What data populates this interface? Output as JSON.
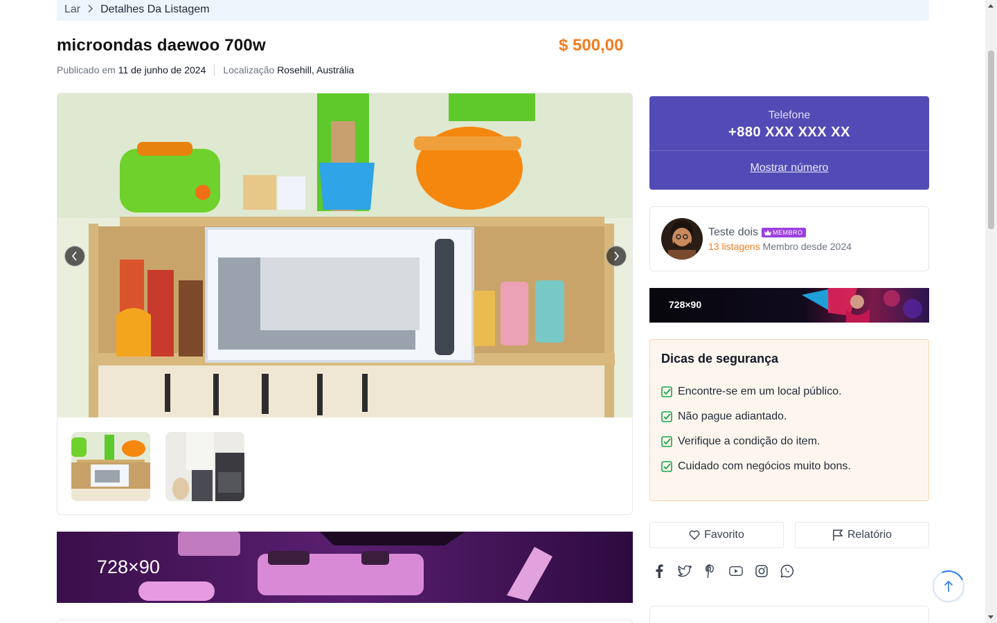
{
  "breadcrumb": {
    "home": "Lar",
    "current": "Detalhes Da Listagem"
  },
  "listing": {
    "title": "microondas daewoo 700w",
    "price": "$ 500,00",
    "published_label": "Publicado em",
    "published_date": "11 de junho de 2024",
    "location_label": "Localização",
    "location": "Rosehill, Austrália"
  },
  "gallery": {
    "thumb_count": 2
  },
  "banners": {
    "side_label": "728×90",
    "bottom_label": "728×90"
  },
  "contact": {
    "phone_label": "Telefone",
    "phone_number": "+880 XXX XXX XX",
    "show_number": "Mostrar número"
  },
  "seller": {
    "name": "Teste dois",
    "badge": "MEMBRO",
    "listings": "13 listagens",
    "member_since": "Membro desde 2024"
  },
  "safety": {
    "title": "Dicas de segurança",
    "tips": [
      "Encontre-se em um local público.",
      "Não pague adiantado.",
      "Verifique a condição do item.",
      "Cuidado com negócios muito bons."
    ]
  },
  "actions": {
    "favorite": "Favorito",
    "report": "Relatório"
  },
  "social": [
    "facebook-icon",
    "twitter-icon",
    "pinterest-icon",
    "youtube-icon",
    "instagram-icon",
    "whatsapp-icon"
  ],
  "colors": {
    "accent_orange": "#f57c1f",
    "phone_card_bg": "#534bb5",
    "tips_bg": "#fef6ee",
    "check_green": "#16a34a",
    "badge_purple": "#9b3fe0"
  }
}
